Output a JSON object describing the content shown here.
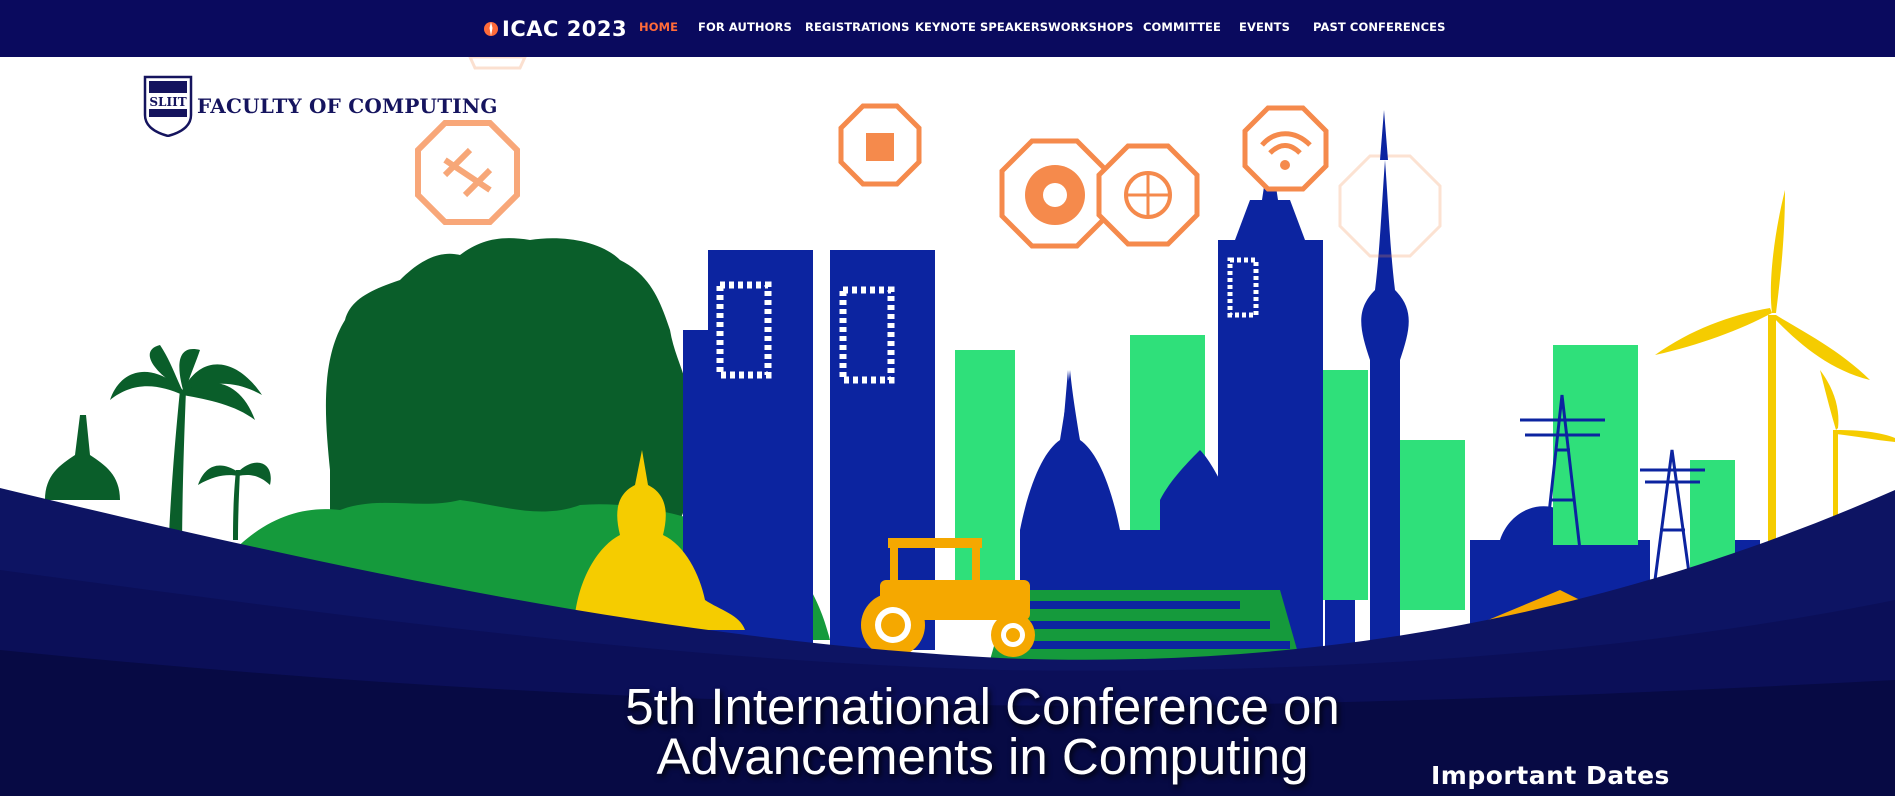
{
  "header": {
    "logo_text": "ICAC 2023",
    "nav": [
      {
        "label": "HOME",
        "active": true
      },
      {
        "label": "FOR AUTHORS",
        "active": false
      },
      {
        "label": "REGISTRATIONS",
        "active": false
      },
      {
        "label": "KEYNOTE SPEAKERS",
        "active": false
      },
      {
        "label": "WORKSHOPS",
        "active": false
      },
      {
        "label": "COMMITTEE",
        "active": false
      },
      {
        "label": "EVENTS",
        "active": false
      },
      {
        "label": "PAST CONFERENCES",
        "active": false
      }
    ]
  },
  "banner": {
    "faculty_logo_text": "FACULTY OF COMPUTING",
    "crest_text": "SLIIT",
    "icons": [
      "satellite-icon",
      "blockchain-cube-icon",
      "global-economy-icon",
      "digital-globe-icon",
      "wifi-icon",
      "cloud-icon"
    ]
  },
  "hero": {
    "title_line1": "5th International Conference on",
    "title_line2": "Advancements in Computing"
  },
  "sidebar": {
    "heading": "Important Dates"
  },
  "colors": {
    "navbar": "#0a0a5e",
    "active_nav": "#ff6a39",
    "icon_orange": "#f58a4c",
    "building_blue": "#0c24a0",
    "building_green": "#2fe07a",
    "foliage_green": "#0a5e2a",
    "ground_dark": "#0a0c52",
    "accent_yellow": "#f5cc00"
  }
}
